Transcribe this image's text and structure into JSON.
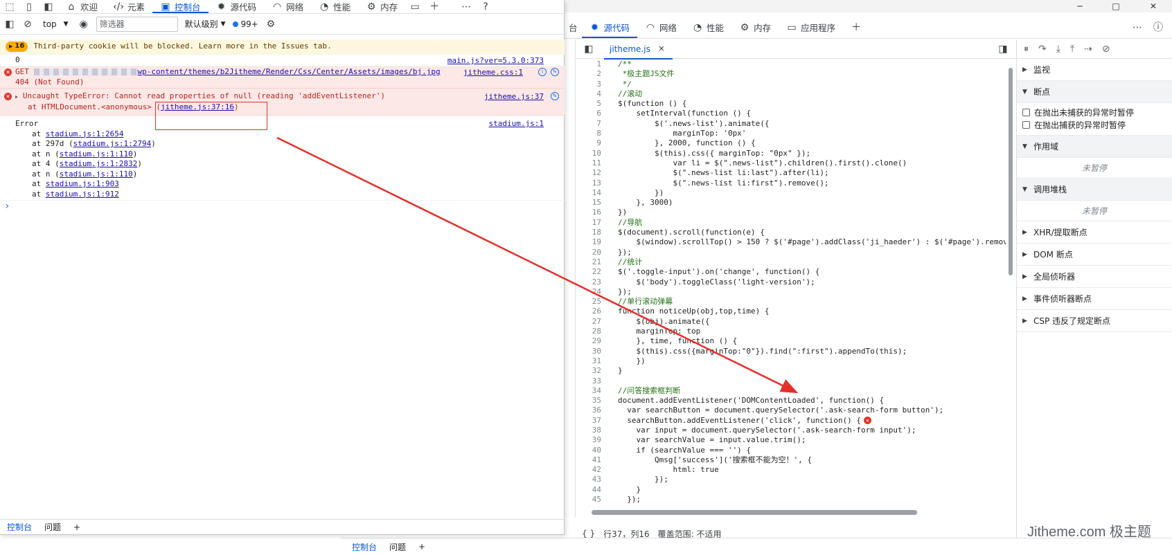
{
  "bg": {
    "titlebar": {
      "minimize": "─",
      "maximize": "□",
      "close": "✕"
    },
    "tabs": [
      {
        "label": "台",
        "icon": ""
      },
      {
        "label": "源代码",
        "icon": "bug-icon",
        "active": true
      },
      {
        "label": "网络",
        "icon": "wifi-icon"
      },
      {
        "label": "性能",
        "icon": "gauge-icon"
      },
      {
        "label": "内存",
        "icon": "chip-icon"
      },
      {
        "label": "应用程序",
        "icon": "app-window-icon"
      }
    ],
    "file_tab": "jitheme.js",
    "status": {
      "braces": "{ }",
      "position": "行37，列16",
      "coverage": "覆盖范围: 不适用"
    },
    "drawer": {
      "tab1": "控制台",
      "tab2": "问题",
      "add": "+"
    },
    "code": [
      {
        "n": "1",
        "t": "/**"
      },
      {
        "n": "2",
        "t": " *极主题JS文件"
      },
      {
        "n": "3",
        "t": " */"
      },
      {
        "n": "4",
        "t": "//滚动"
      },
      {
        "n": "5",
        "t": "$(function () {"
      },
      {
        "n": "6",
        "t": "    setInterval(function () {"
      },
      {
        "n": "7",
        "t": "        $('.news-list').animate({"
      },
      {
        "n": "8",
        "t": "            marginTop: '0px'"
      },
      {
        "n": "9",
        "t": "        }, 2000, function () {"
      },
      {
        "n": "10",
        "t": "        $(this).css({ marginTop: \"0px\" });"
      },
      {
        "n": "11",
        "t": "            var li = $(\".news-list\").children().first().clone()"
      },
      {
        "n": "12",
        "t": "            $(\".news-list li:last\").after(li);"
      },
      {
        "n": "13",
        "t": "            $(\".news-list li:first\").remove();"
      },
      {
        "n": "14",
        "t": "        })"
      },
      {
        "n": "15",
        "t": "    }, 3000)"
      },
      {
        "n": "16",
        "t": "})"
      },
      {
        "n": "17",
        "t": "//导航"
      },
      {
        "n": "18",
        "t": "$(document).scroll(function(e) {"
      },
      {
        "n": "19",
        "t": "    $(window).scrollTop() > 150 ? $('#page').addClass('ji_haeder') : $('#page').remov"
      },
      {
        "n": "20",
        "t": "});"
      },
      {
        "n": "21",
        "t": "//统计"
      },
      {
        "n": "22",
        "t": "$('.toggle-input').on('change', function() {"
      },
      {
        "n": "23",
        "t": "    $('body').toggleClass('light-version');"
      },
      {
        "n": "24",
        "t": "});"
      },
      {
        "n": "25",
        "t": "//单行滚动弹幕"
      },
      {
        "n": "26",
        "t": "function noticeUp(obj,top,time) {"
      },
      {
        "n": "27",
        "t": "    $(obj).animate({"
      },
      {
        "n": "28",
        "t": "    marginTop: top"
      },
      {
        "n": "29",
        "t": "    }, time, function () {"
      },
      {
        "n": "30",
        "t": "    $(this).css({marginTop:\"0\"}).find(\":first\").appendTo(this);"
      },
      {
        "n": "31",
        "t": "    })"
      },
      {
        "n": "32",
        "t": "}"
      },
      {
        "n": "33",
        "t": ""
      },
      {
        "n": "34",
        "t": "//问答搜索框判断"
      },
      {
        "n": "35",
        "t": "document.addEventListener('DOMContentLoaded', function() {"
      },
      {
        "n": "36",
        "t": "  var searchButton = document.querySelector('.ask-search-form button');"
      },
      {
        "n": "37",
        "t": "  searchButton.addEventListener('click', function() {"
      },
      {
        "n": "38",
        "t": "    var input = document.querySelector('.ask-search-form input');"
      },
      {
        "n": "39",
        "t": "    var searchValue = input.value.trim();"
      },
      {
        "n": "40",
        "t": "    if (searchValue === '') {"
      },
      {
        "n": "41",
        "t": "        Qmsg['success']('搜索框不能为空！', {"
      },
      {
        "n": "42",
        "t": "            html: true"
      },
      {
        "n": "43",
        "t": "        });"
      },
      {
        "n": "44",
        "t": "    }"
      },
      {
        "n": "45",
        "t": "  });"
      }
    ],
    "sidebar": {
      "sections": [
        {
          "label": "监视",
          "expanded": false
        },
        {
          "label": "断点",
          "expanded": true
        }
      ],
      "checks": [
        "在抛出未捕获的异常时暂停",
        "在抛出捕获的异常时暂停"
      ],
      "scope_label": "作用域",
      "not_paused": "未暂停",
      "callstack_label": "调用堆栈",
      "more_sections": [
        "XHR/提取断点",
        "DOM 断点",
        "全局侦听器",
        "事件侦听器断点",
        "CSP 违反了规定断点"
      ]
    },
    "watermark": "Jitheme.com 极主题"
  },
  "fg": {
    "tabs": [
      {
        "label": "欢迎",
        "icon": "home-icon"
      },
      {
        "label": "元素",
        "icon": "code-icon"
      },
      {
        "label": "控制台",
        "icon": "console-icon",
        "active": true
      },
      {
        "label": "源代码",
        "icon": "bug-icon"
      },
      {
        "label": "网络",
        "icon": "wifi-icon"
      },
      {
        "label": "性能",
        "icon": "gauge-icon"
      },
      {
        "label": "内存",
        "icon": "chip-icon"
      }
    ],
    "toolbar": {
      "context": "top",
      "filter_placeholder": "筛选器",
      "level": "默认级别",
      "issues": "99+"
    },
    "messages": {
      "warning": {
        "count": "16",
        "text": "Third-party cookie will be blocked. Learn more in the Issues tab."
      },
      "log0": {
        "text": "0",
        "src": "main.js?ver=5.3.0:373"
      },
      "get_error": {
        "prefix": "GET",
        "url_tail": "wp-content/themes/b2Jitheme/Render/Css/Center/Assets/images/bj.jpg",
        "status": "404 (Not Found)",
        "src": "jitheme.css:1"
      },
      "type_error": {
        "line1": "Uncaught TypeError: Cannot read properties of null (reading 'addEventListener')",
        "line2_prefix": "at HTMLDocument.<anonymous> (",
        "line2_link": "jitheme.js:37:16",
        "line2_suffix": ")",
        "src": "jitheme.js:37"
      },
      "error_block": {
        "title": "Error",
        "src": "stadium.js:1",
        "stack": [
          {
            "pre": "at ",
            "link": "stadium.js:1:2654",
            "post": ""
          },
          {
            "pre": "at 297d (",
            "link": "stadium.js:1:2794",
            "post": ")"
          },
          {
            "pre": "at n (",
            "link": "stadium.js:1:110",
            "post": ")"
          },
          {
            "pre": "at 4 (",
            "link": "stadium.js:1:2832",
            "post": ")"
          },
          {
            "pre": "at n (",
            "link": "stadium.js:1:110",
            "post": ")"
          },
          {
            "pre": "at ",
            "link": "stadium.js:1:903",
            "post": ""
          },
          {
            "pre": "at ",
            "link": "stadium.js:1:912",
            "post": ""
          }
        ]
      }
    },
    "drawer": {
      "tab1": "控制台",
      "tab2": "问题",
      "add": "+"
    }
  }
}
